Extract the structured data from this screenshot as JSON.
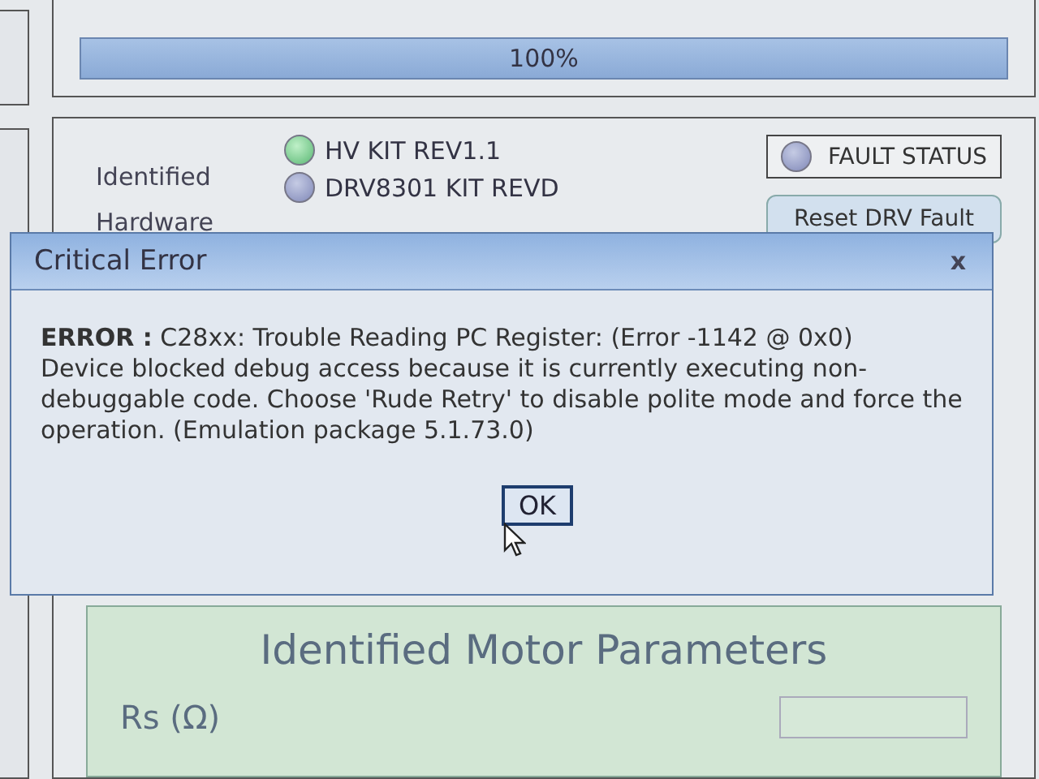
{
  "progress": {
    "level": 1.0,
    "reading": "100%"
  },
  "hardware": {
    "label": "Identified Hardware",
    "items": [
      {
        "label": "HV KIT REV1.1",
        "on": true
      },
      {
        "label": "DRV8301 KIT REVD",
        "on": false
      }
    ]
  },
  "fault": {
    "label": "FAULT STATUS",
    "on": false
  },
  "reset_button": "Reset DRV Fault",
  "motor": {
    "title": "Identified Motor Parameters",
    "params": [
      {
        "label": "Rs (Ω)"
      }
    ]
  },
  "dialog": {
    "title": "Critical Error",
    "close": "x",
    "error": "**ERROR :** C28xx: Trouble Reading PC Register: (Error -1142 @ 0x0)",
    "message": "Device blocked debug access because it is currently executing non-debuggable code. Choose 'Rude Retry' to disable polite mode and force the operation. (Emulation package 5.1.73.0)",
    "button": "OK"
  }
}
